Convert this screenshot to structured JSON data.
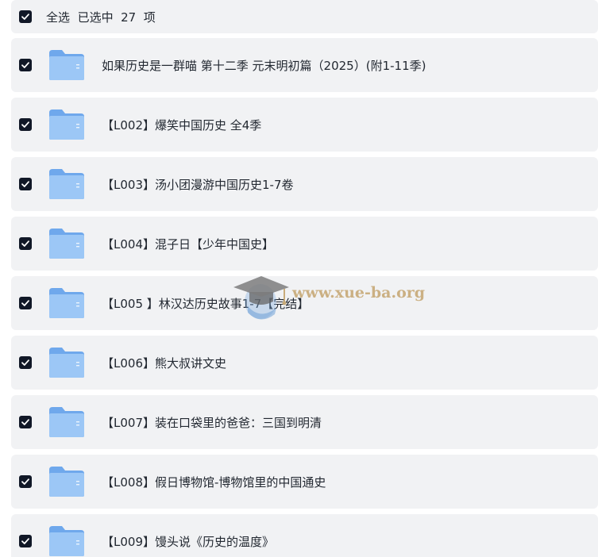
{
  "header": {
    "select_all_label": "全选",
    "selected_label": "已选中",
    "selected_count": "27",
    "count_unit": "项",
    "checked": true
  },
  "items": [
    {
      "label": "如果历史是一群喵 第十二季  元末明初篇（2025）(附1-11季)",
      "checked": true,
      "icon": "folder-icon"
    },
    {
      "label": "【L002】爆笑中国历史 全4季",
      "checked": true,
      "icon": "folder-icon"
    },
    {
      "label": "【L003】汤小团漫游中国历史1-7卷",
      "checked": true,
      "icon": "folder-icon"
    },
    {
      "label": "【L004】混子日【少年中国史】",
      "checked": true,
      "icon": "folder-icon"
    },
    {
      "label": "【L005 】林汉达历史故事1-7【完结】",
      "checked": true,
      "icon": "folder-icon"
    },
    {
      "label": "【L006】熊大叔讲文史",
      "checked": true,
      "icon": "folder-icon"
    },
    {
      "label": "【L007】装在口袋里的爸爸：三国到明清",
      "checked": true,
      "icon": "folder-icon"
    },
    {
      "label": "【L008】假日博物馆-博物馆里的中国通史",
      "checked": true,
      "icon": "folder-icon"
    },
    {
      "label": "【L009】馒头说《历史的温度》",
      "checked": true,
      "icon": "folder-icon"
    }
  ],
  "watermark": {
    "text": "www.xue-ba.org",
    "icon": "graduation-cap-icon"
  },
  "colors": {
    "row_background": "#f1f2f4",
    "checkbox": "#111827",
    "folder_back": "#6fa8ec",
    "folder_front": "#9cc7f6",
    "watermark": "#c4a46e"
  }
}
